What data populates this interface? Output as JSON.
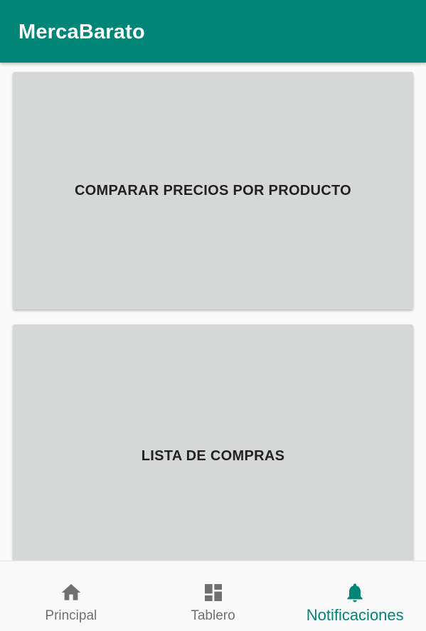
{
  "appbar": {
    "title": "MercaBarato",
    "color": "#008577"
  },
  "main": {
    "buttons": [
      {
        "label": "COMPARAR PRECIOS POR PRODUCTO"
      },
      {
        "label": "LISTA DE COMPRAS"
      }
    ],
    "button_color": "#d6d7d7"
  },
  "bottom_nav": {
    "items": [
      {
        "label": "Principal",
        "icon": "home-icon",
        "active": false
      },
      {
        "label": "Tablero",
        "icon": "dashboard-icon",
        "active": false
      },
      {
        "label": "Notificaciones",
        "icon": "bell-icon",
        "active": true
      }
    ],
    "active_color": "#008577",
    "inactive_color": "#707070"
  }
}
